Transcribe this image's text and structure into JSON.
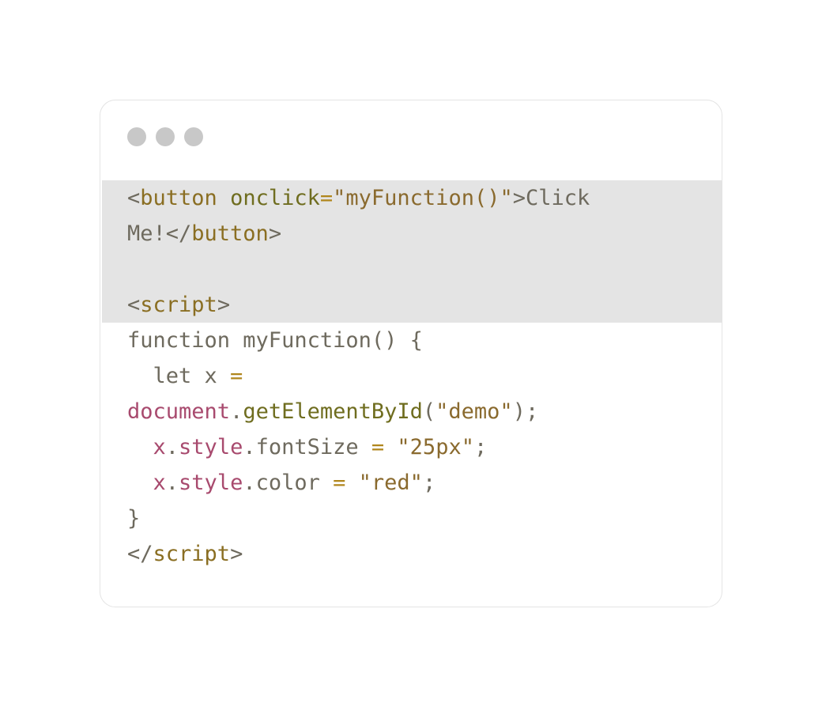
{
  "window": {
    "dots": [
      "red",
      "yellow",
      "green"
    ]
  },
  "code": {
    "lines": [
      [
        {
          "t": "<",
          "c": "plain"
        },
        {
          "t": "button",
          "c": "tag"
        },
        {
          "t": " ",
          "c": "plain"
        },
        {
          "t": "onclick",
          "c": "attr"
        },
        {
          "t": "=",
          "c": "op"
        },
        {
          "t": "\"myFunction()\"",
          "c": "str"
        },
        {
          "t": ">Click",
          "c": "plain"
        }
      ],
      [
        {
          "t": "Me!</",
          "c": "plain"
        },
        {
          "t": "button",
          "c": "tag"
        },
        {
          "t": ">",
          "c": "plain"
        }
      ],
      [],
      [
        {
          "t": "<",
          "c": "plain"
        },
        {
          "t": "script",
          "c": "tag"
        },
        {
          "t": ">",
          "c": "plain"
        }
      ],
      [
        {
          "t": "function myFunction() {",
          "c": "plain"
        }
      ],
      [
        {
          "t": "  let x ",
          "c": "plain"
        },
        {
          "t": "=",
          "c": "op"
        }
      ],
      [
        {
          "t": "document",
          "c": "obj"
        },
        {
          "t": ".",
          "c": "plain"
        },
        {
          "t": "getElementById",
          "c": "meth"
        },
        {
          "t": "(",
          "c": "plain"
        },
        {
          "t": "\"demo\"",
          "c": "str"
        },
        {
          "t": ");",
          "c": "plain"
        }
      ],
      [
        {
          "t": "  ",
          "c": "plain"
        },
        {
          "t": "x",
          "c": "obj"
        },
        {
          "t": ".",
          "c": "plain"
        },
        {
          "t": "style",
          "c": "obj"
        },
        {
          "t": ".fontSize ",
          "c": "plain"
        },
        {
          "t": "=",
          "c": "op"
        },
        {
          "t": " ",
          "c": "plain"
        },
        {
          "t": "\"25px\"",
          "c": "str"
        },
        {
          "t": ";",
          "c": "plain"
        }
      ],
      [
        {
          "t": "  ",
          "c": "plain"
        },
        {
          "t": "x",
          "c": "obj"
        },
        {
          "t": ".",
          "c": "plain"
        },
        {
          "t": "style",
          "c": "obj"
        },
        {
          "t": ".color ",
          "c": "plain"
        },
        {
          "t": "=",
          "c": "op"
        },
        {
          "t": " ",
          "c": "plain"
        },
        {
          "t": "\"red\"",
          "c": "str"
        },
        {
          "t": ";",
          "c": "plain"
        }
      ],
      [
        {
          "t": "}",
          "c": "plain"
        }
      ],
      [
        {
          "t": "</",
          "c": "plain"
        },
        {
          "t": "script",
          "c": "tag"
        },
        {
          "t": ">",
          "c": "plain"
        }
      ]
    ]
  },
  "colors": {
    "window_border": "#e4e4e4",
    "highlight": "#e4e4e4",
    "dot": "#c8c8c8",
    "plain": "#6e6a5e",
    "tag": "#8a6e22",
    "attr": "#6f6d1f",
    "string": "#8a6a2e",
    "operator": "#b0861c",
    "object": "#a84a6e",
    "method": "#6f6d1f"
  }
}
